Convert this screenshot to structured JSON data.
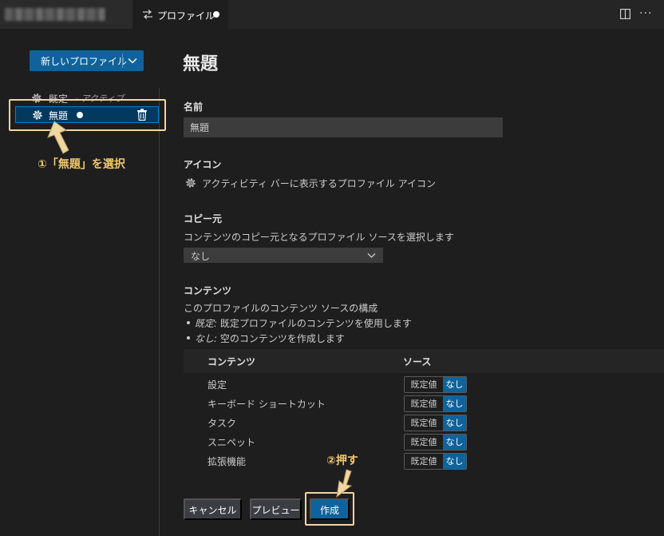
{
  "tab": {
    "label": "プロファイル",
    "icon": "profile-arrows-icon",
    "dirty": true
  },
  "sidebar": {
    "new_profile_label": "新しいプロファイル",
    "profiles": [
      {
        "name": "既定",
        "tag": "- アクティブ",
        "icon": "gear-icon"
      },
      {
        "name": "無題",
        "icon": "gear-icon",
        "dirty": true,
        "selected": true
      }
    ]
  },
  "main": {
    "title": "無題",
    "name_label": "名前",
    "name_value": "無題",
    "icon_label": "アイコン",
    "icon_desc": "アクティビティ バーに表示するプロファイル アイコン",
    "copy_label": "コピー元",
    "copy_desc": "コンテンツのコピー元となるプロファイル ソースを選択します",
    "copy_value": "なし",
    "contents_label": "コンテンツ",
    "contents_desc": "このプロファイルのコンテンツ ソースの構成",
    "bullets": [
      {
        "term": "既定:",
        "text": "既定プロファイルのコンテンツを使用します"
      },
      {
        "term": "なし:",
        "text": "空のコンテンツを作成します"
      }
    ],
    "table": {
      "col_content": "コンテンツ",
      "col_source": "ソース",
      "rows": [
        {
          "name": "設定",
          "opt_a": "既定値",
          "opt_b": "なし"
        },
        {
          "name": "キーボード ショートカット",
          "opt_a": "既定値",
          "opt_b": "なし"
        },
        {
          "name": "タスク",
          "opt_a": "既定値",
          "opt_b": "なし"
        },
        {
          "name": "スニペット",
          "opt_a": "既定値",
          "opt_b": "なし"
        },
        {
          "name": "拡張機能",
          "opt_a": "既定値",
          "opt_b": "なし"
        }
      ]
    },
    "buttons": {
      "cancel": "キャンセル",
      "preview": "プレビュー",
      "create": "作成"
    }
  },
  "annotations": {
    "step1": "①「無題」を選択",
    "step2": "②押す"
  },
  "colors": {
    "accent": "#0e639c",
    "annotation": "#f2c66d",
    "annotation_border": "#f0d6a1"
  }
}
